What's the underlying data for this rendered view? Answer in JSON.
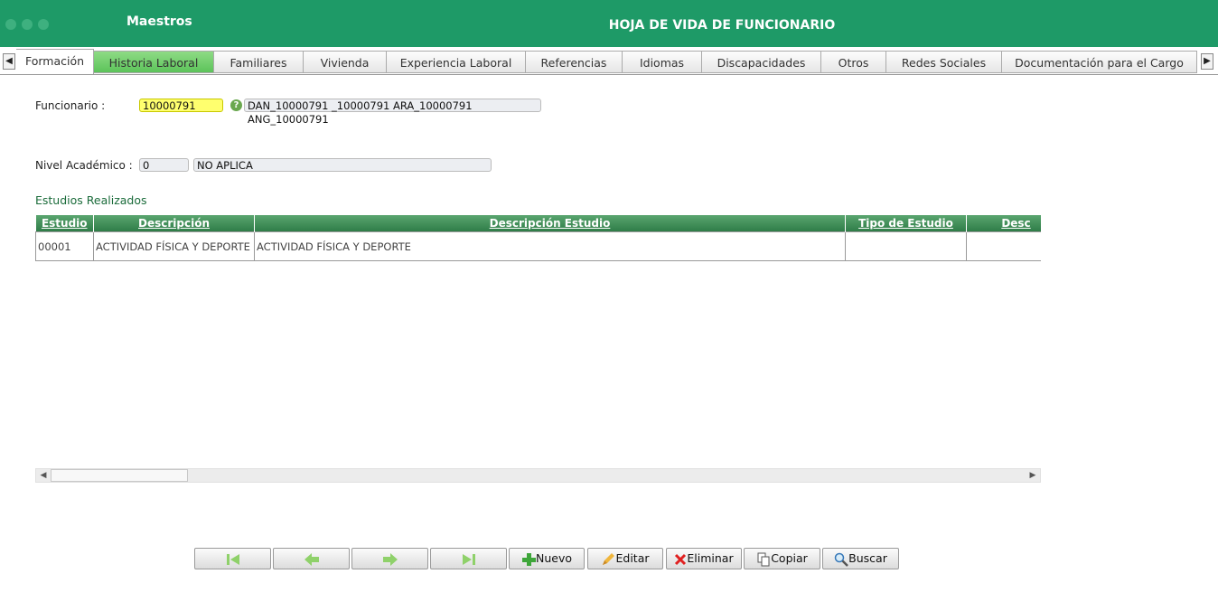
{
  "header": {
    "app_label": "Maestros",
    "title": "HOJA DE VIDA DE FUNCIONARIO"
  },
  "tabs": [
    {
      "label": "Formación"
    },
    {
      "label": "Historia Laboral"
    },
    {
      "label": "Familiares"
    },
    {
      "label": "Vivienda"
    },
    {
      "label": "Experiencia Laboral"
    },
    {
      "label": "Referencias"
    },
    {
      "label": "Idiomas"
    },
    {
      "label": "Discapacidades"
    },
    {
      "label": "Otros"
    },
    {
      "label": "Redes Sociales"
    },
    {
      "label": "Documentación para el Cargo"
    }
  ],
  "form": {
    "funcionario_label": "Funcionario :",
    "funcionario_value": "10000791",
    "funcionario_name": "DAN_10000791 _10000791 ARA_10000791 ANG_10000791",
    "nivel_label": "Nivel Académico :",
    "nivel_code": "0",
    "nivel_desc": "NO APLICA"
  },
  "grid": {
    "title": "Estudios Realizados",
    "columns": [
      "Estudio",
      "Descripción",
      "Descripción Estudio",
      "Tipo de Estudio",
      "Desc"
    ],
    "rows": [
      [
        "00001",
        "ACTIVIDAD FÍSICA Y DEPORTE",
        "ACTIVIDAD FÍSICA Y DEPORTE",
        "",
        ""
      ]
    ]
  },
  "toolbar": {
    "nuevo": "Nuevo",
    "editar": "Editar",
    "eliminar": "Eliminar",
    "copiar": "Copiar",
    "buscar": "Buscar"
  },
  "colors": {
    "header_bg": "#1e9a67",
    "tab_highlight": "#6fcd6a",
    "field_highlight": "#ffff6e",
    "grid_header": "#3d8a55"
  }
}
